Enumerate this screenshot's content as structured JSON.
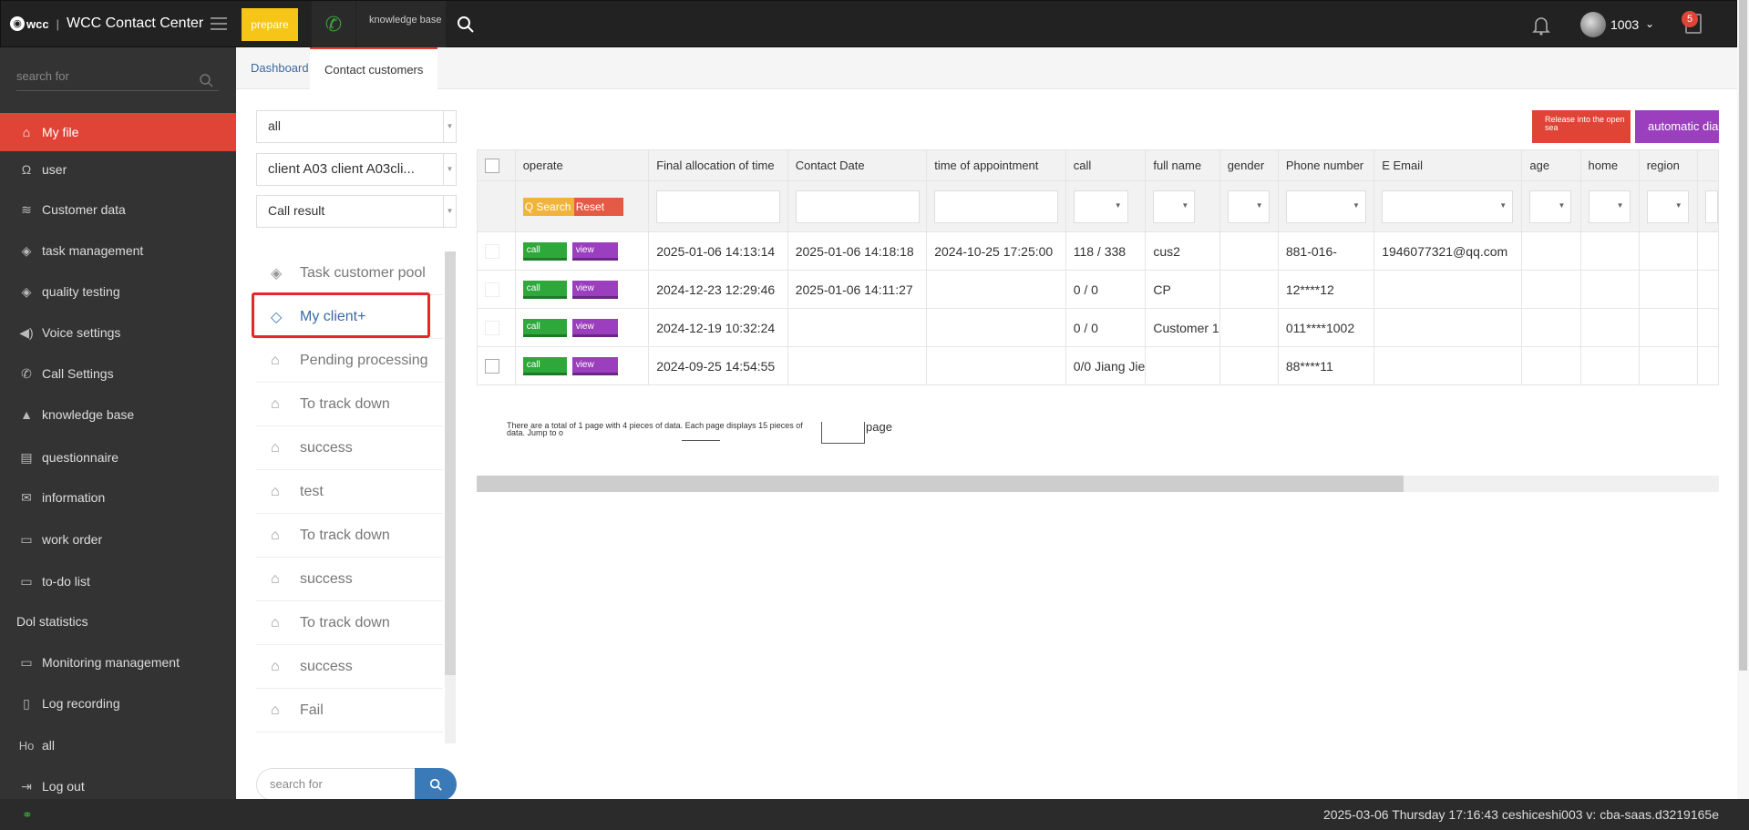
{
  "header": {
    "brand_mark": "wcc",
    "app_title": "WCC Contact Center",
    "prepare_label": "prepare",
    "knowledge_base_label": "knowledge base",
    "user_id": "1003",
    "notification_count": "5"
  },
  "sidebar": {
    "search_placeholder": "search for",
    "items": [
      {
        "label": "My file",
        "icon": "home-icon"
      },
      {
        "label": "user",
        "icon": "omega-icon"
      },
      {
        "label": "Customer data",
        "icon": "database-icon"
      },
      {
        "label": "task management",
        "icon": "layers-icon"
      },
      {
        "label": "quality testing",
        "icon": "layers-icon"
      },
      {
        "label": "Voice settings",
        "icon": "speaker-icon"
      },
      {
        "label": "Call Settings",
        "icon": "phone-icon"
      },
      {
        "label": "knowledge base",
        "icon": "graduation-cap-icon"
      },
      {
        "label": "questionnaire",
        "icon": "document-icon"
      },
      {
        "label": "information",
        "icon": "envelope-icon"
      },
      {
        "label": "work order",
        "icon": "folder-icon"
      },
      {
        "label": "to-do list",
        "icon": "folder-icon"
      },
      {
        "label": "Dol statistics",
        "icon": ""
      },
      {
        "label": "Monitoring management",
        "icon": "monitor-icon"
      },
      {
        "label": "Log recording",
        "icon": "book-icon"
      },
      {
        "label": "all",
        "icon": "Ho"
      },
      {
        "label": "Log out",
        "icon": "logout-icon"
      }
    ]
  },
  "tabs": [
    {
      "label": "Dashboard"
    },
    {
      "label": "Contact customers"
    }
  ],
  "filters": {
    "scope": "all",
    "client": "client A03 client A03cli...",
    "call_result": "Call result"
  },
  "customer_lists": [
    {
      "label": "Task customer pool",
      "icon": "layers-icon"
    },
    {
      "label": "My client+",
      "icon": "diamond-icon"
    },
    {
      "label": "Pending processing",
      "icon": "tag-icon"
    },
    {
      "label": "To track down",
      "icon": "tag-icon"
    },
    {
      "label": "success",
      "icon": "tag-icon"
    },
    {
      "label": "test",
      "icon": "tag-icon"
    },
    {
      "label": "To track down",
      "icon": "tag-icon"
    },
    {
      "label": "success",
      "icon": "tag-icon"
    },
    {
      "label": "To track down",
      "icon": "tag-icon"
    },
    {
      "label": "success",
      "icon": "tag-icon"
    },
    {
      "label": "Fail",
      "icon": "tag-icon"
    }
  ],
  "list_search_placeholder": "search for",
  "actions": {
    "release_label": "Release into the open sea",
    "auto_dial_label": "automatic dial"
  },
  "table": {
    "columns": [
      "operate",
      "Final allocation of time",
      "Contact Date",
      "time of appointment",
      "call",
      "full name",
      "gender",
      "Phone number",
      "E Email",
      "age",
      "home",
      "region"
    ],
    "search_label": "Q Search",
    "reset_label": "Reset",
    "call_label": "call",
    "view_label": "view",
    "rows": [
      {
        "final_alloc": "2025-01-06 14:13:14",
        "contact_date": "2025-01-06 14:18:18",
        "appointment": "2024-10-25 17:25:00",
        "call": "118 / 338",
        "name": "cus2",
        "gender": "",
        "phone": "881-016-",
        "email": "1946077321@qq.com",
        "age": "",
        "home": "",
        "region": ""
      },
      {
        "final_alloc": "2024-12-23 12:29:46",
        "contact_date": "2025-01-06 14:11:27",
        "appointment": "",
        "call": "0 / 0",
        "name": "CP",
        "gender": "",
        "phone": "12****12",
        "email": "",
        "age": "",
        "home": "",
        "region": ""
      },
      {
        "final_alloc": "2024-12-19 10:32:24",
        "contact_date": "",
        "appointment": "",
        "call": "0 / 0",
        "name": "Customer 1",
        "gender": "",
        "phone": "011****1002",
        "email": "",
        "age": "",
        "home": "",
        "region": ""
      },
      {
        "final_alloc": "2024-09-25 14:54:55",
        "contact_date": "",
        "appointment": "",
        "call": "0/0 Jiang Jie",
        "name": "",
        "gender": "",
        "phone": "88****11",
        "email": "",
        "age": "",
        "home": "",
        "region": ""
      }
    ]
  },
  "pagination": {
    "summary": "There are a total of 1 page with 4 pieces of data. Each page displays 15 pieces of data. Jump to o",
    "page_label": "page"
  },
  "status_bar": {
    "info": "2025-03-06 Thursday 17:16:43   ceshiceshi003   v: cba-saas.d3219165e"
  },
  "colors": {
    "accent_red": "#e04437",
    "prepare_yellow": "#f5c518",
    "call_green": "#2ea83a",
    "view_purple": "#9b3fbf",
    "sidebar_bg": "#333333"
  }
}
